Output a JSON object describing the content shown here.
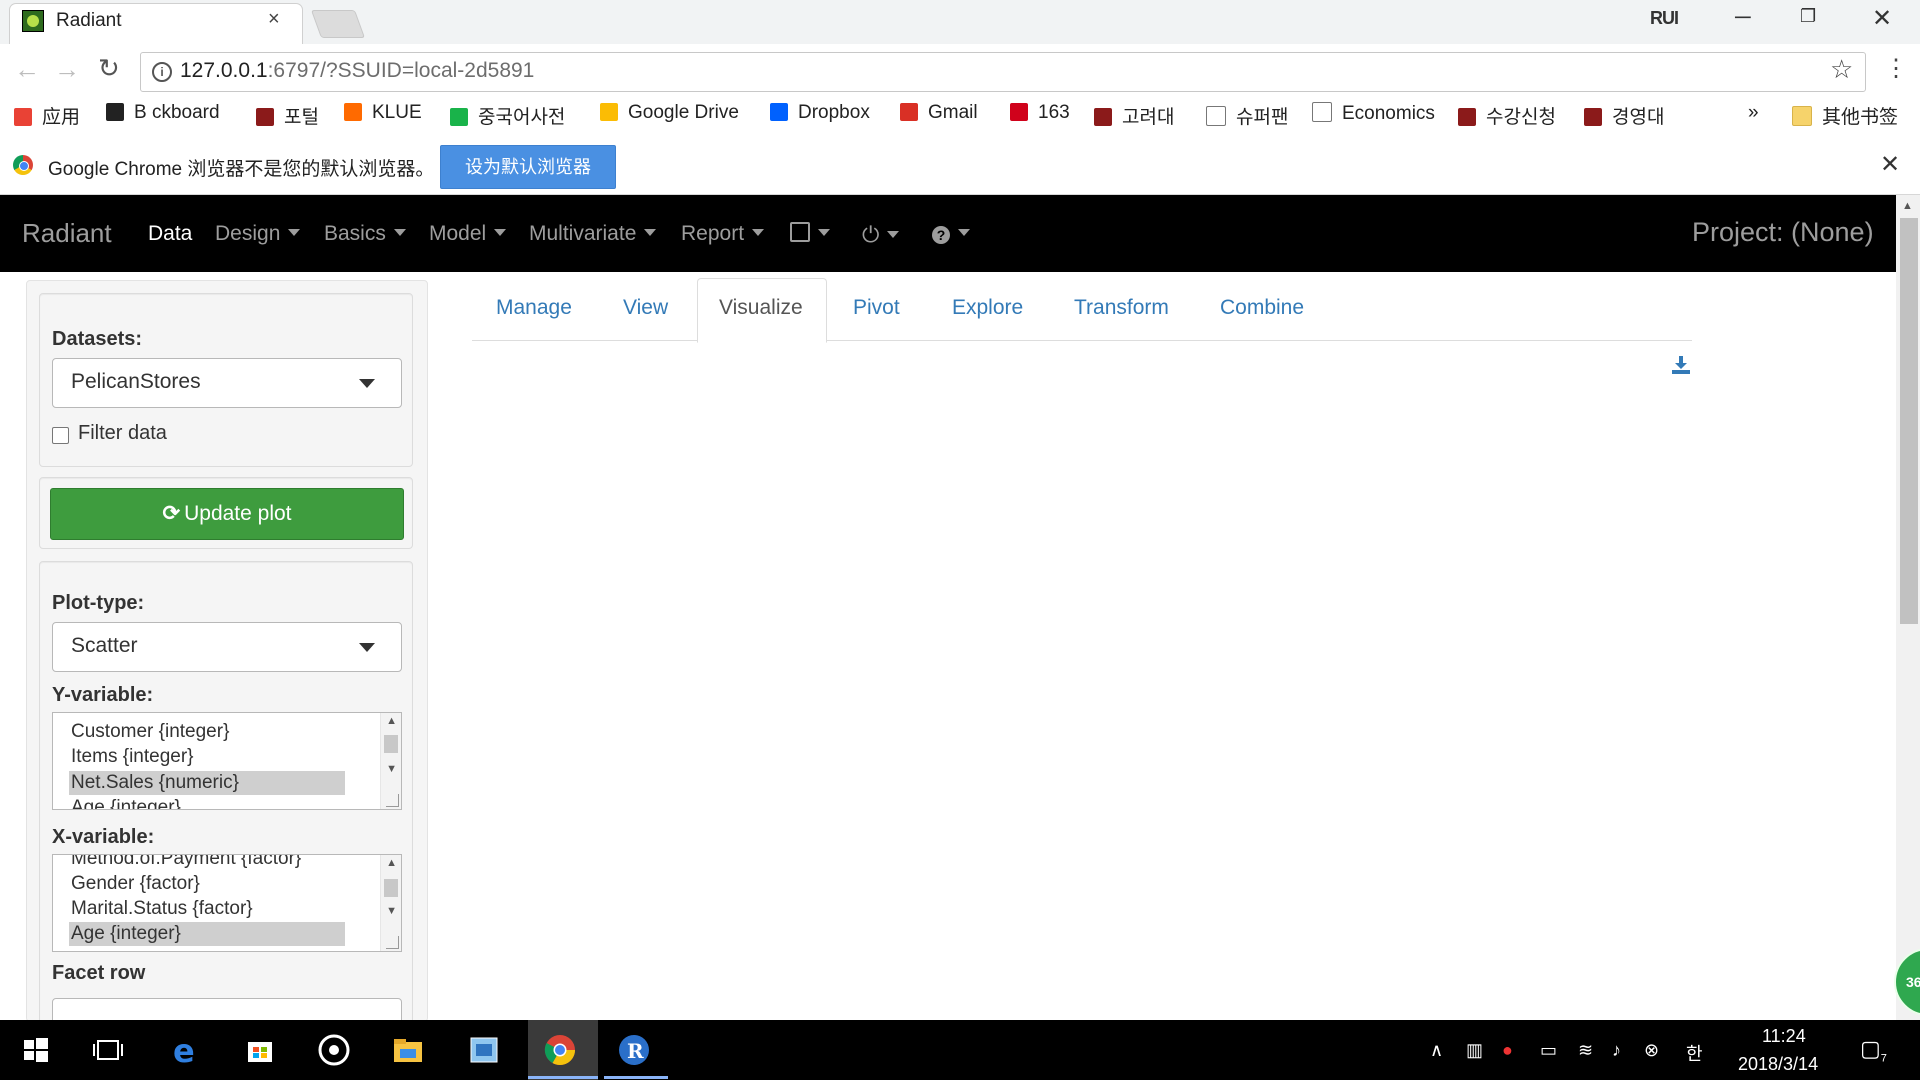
{
  "browser": {
    "tab_title": "Radiant",
    "tab_close": "×",
    "window_user": "RUI",
    "win_min": "─",
    "win_max": "❐",
    "win_close": "✕",
    "url_host": "127.0.0.1",
    "url_rest": ":6797/?SSUID=local-2d5891",
    "back": "←",
    "forward": "→",
    "reload": "↻",
    "star": "☆",
    "menu": "⋮",
    "bookmarks": [
      {
        "label": "应用",
        "icon": "apps-grid-icon",
        "color": "#e94235"
      },
      {
        "label": "B  ckboard",
        "icon": "blackboard-icon",
        "color": "#222222"
      },
      {
        "label": "포털",
        "icon": "korea-univ-crest-icon",
        "color": "#8b1a1a"
      },
      {
        "label": "KLUE",
        "icon": "klue-icon",
        "color": "#ff6a00"
      },
      {
        "label": "중국어사전",
        "icon": "dict-icon",
        "color": "#19b34a"
      },
      {
        "label": "Google Drive",
        "icon": "google-drive-icon",
        "color": "#fbbc04"
      },
      {
        "label": "Dropbox",
        "icon": "dropbox-icon",
        "color": "#0061fe"
      },
      {
        "label": "Gmail",
        "icon": "gmail-icon",
        "color": "#d93025"
      },
      {
        "label": "163",
        "icon": "netease-icon",
        "color": "#d0021b"
      },
      {
        "label": "고려대",
        "icon": "korea-univ-shield-icon",
        "color": "#8b1a1a"
      },
      {
        "label": "슈퍼팬",
        "icon": "page-icon",
        "color": "#ffffff"
      },
      {
        "label": "Economics",
        "icon": "page-icon",
        "color": "#ffffff"
      },
      {
        "label": "수강신청",
        "icon": "korea-univ-crest-icon",
        "color": "#8b1a1a"
      },
      {
        "label": "경영대",
        "icon": "korea-univ-shield-icon",
        "color": "#8b1a1a"
      }
    ],
    "bookmarks_overflow": "»",
    "other_bookmarks": "其他书签"
  },
  "infobar": {
    "message": "Google Chrome 浏览器不是您的默认浏览器。",
    "button": "设为默认浏览器",
    "close": "✕"
  },
  "navbar": {
    "brand": "Radiant",
    "items": [
      "Data",
      "Design",
      "Basics",
      "Model",
      "Multivariate",
      "Report"
    ],
    "active": "Data",
    "project": "Project: (None)"
  },
  "sidebar": {
    "datasets_label": "Datasets:",
    "dataset_value": "PelicanStores",
    "filter_label": "Filter data",
    "update_button": "Update plot",
    "plot_type_label": "Plot-type:",
    "plot_type_value": "Scatter",
    "y_label": "Y-variable:",
    "y_options": [
      "Customer {integer}",
      "Items {integer}",
      "Net.Sales {numeric}",
      "Age {integer}"
    ],
    "y_selected": "Net.Sales {numeric}",
    "x_label": "X-variable:",
    "x_options": [
      "Method.of.Payment {factor}",
      "Gender {factor}",
      "Marital.Status {factor}",
      "Age {integer}"
    ],
    "x_selected": "Age {integer}",
    "facet_row_label": "Facet row"
  },
  "tabs": [
    "Manage",
    "View",
    "Visualize",
    "Pivot",
    "Explore",
    "Transform",
    "Combine"
  ],
  "active_tab": "Visualize",
  "colors": {
    "navbar_bg": "#000000",
    "link": "#337ab7",
    "update_button": "#3e9c3e",
    "infobar_button": "#4a90e2"
  },
  "badge": "36",
  "taskbar": {
    "time": "11:24",
    "date": "2018/3/14",
    "notifications": "7",
    "ime": "한"
  }
}
